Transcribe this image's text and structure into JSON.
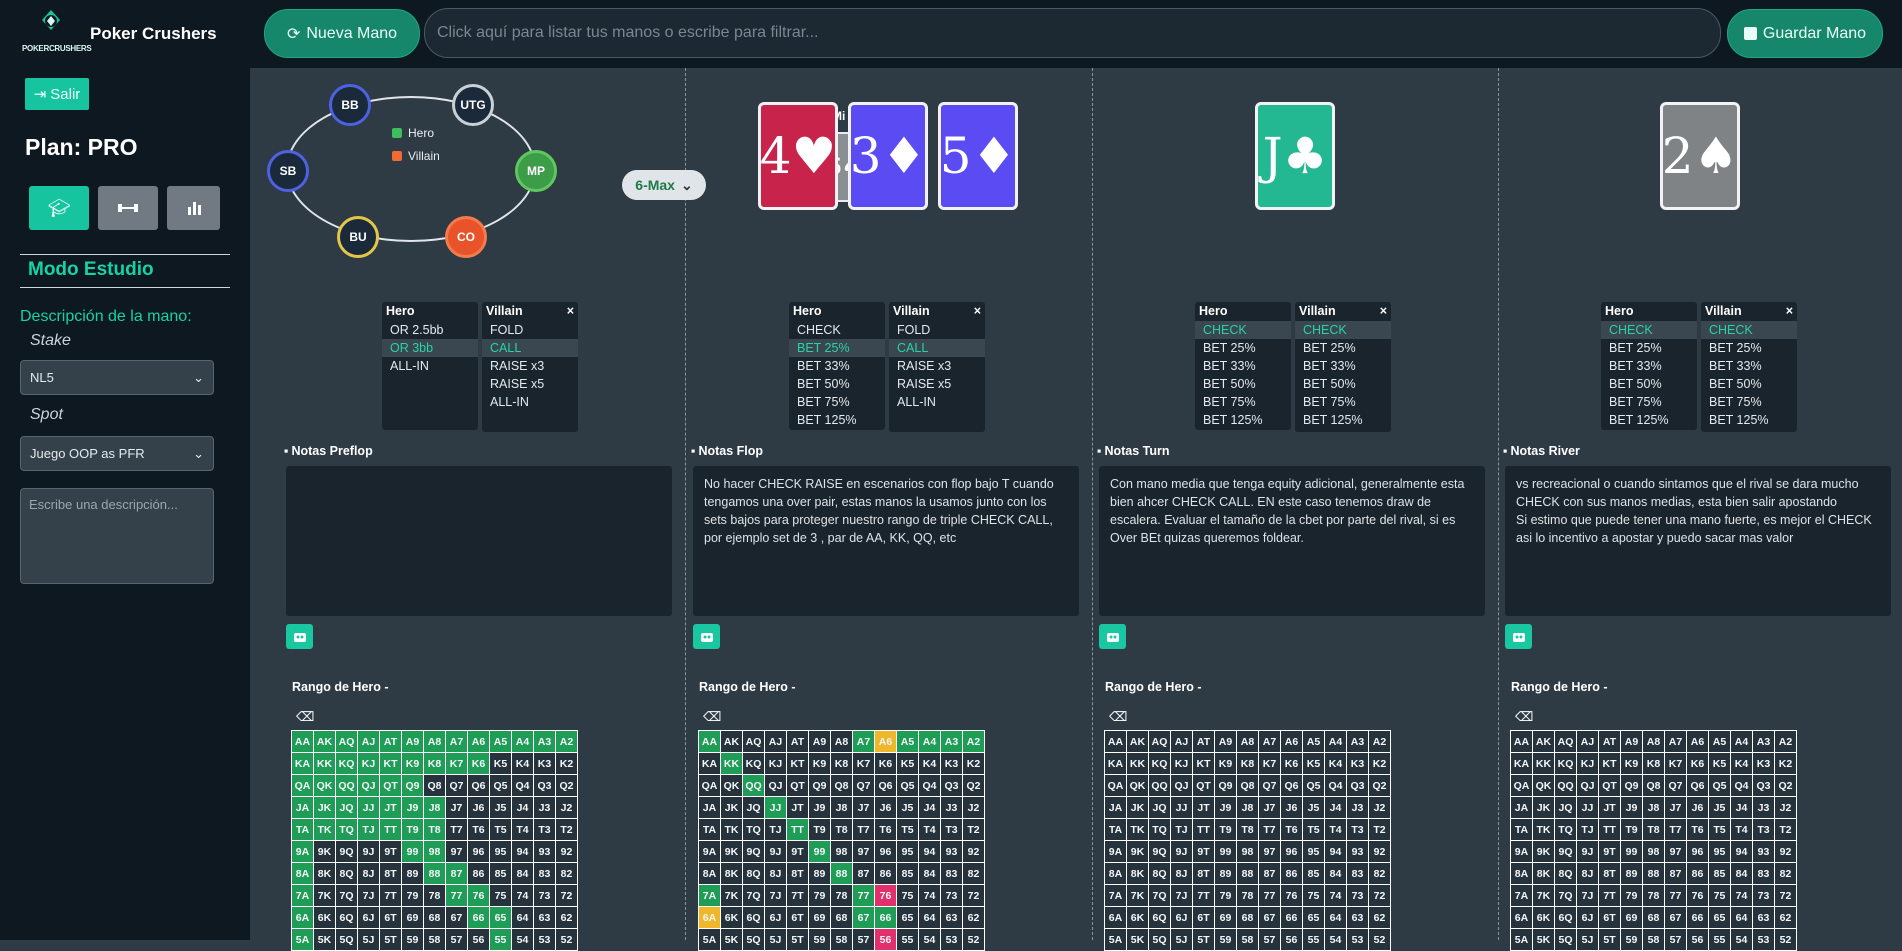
{
  "header": {
    "brand": "Poker Crushers",
    "logo_text": "POKERCRUSHERS",
    "new_hand_label": "Nueva Mano",
    "search_placeholder": "Click aquí para listar tus manos o escribe para filtrar...",
    "save_label": "Guardar Mano"
  },
  "sidebar": {
    "logout_label": "Salir",
    "plan_label": "Plan: PRO",
    "mode_title": "Modo Estudio",
    "description_label": "Descripción de la mano:",
    "stake_label": "Stake",
    "stake_value": "NL5",
    "spot_label": "Spot",
    "spot_value": "Juego OOP as PFR",
    "description_placeholder": "Escribe una descripción..."
  },
  "table": {
    "seats": [
      "BB",
      "UTG",
      "SB",
      "MP",
      "BU",
      "CO"
    ],
    "legend_hero": "Hero",
    "legend_villain": "Villain",
    "format": "6-Max",
    "my_hand_label": "Mi mano",
    "my_hand": [
      {
        "rank": "6",
        "suit": "♠",
        "color": "#8a8f94"
      },
      {
        "rank": "6",
        "suit": "♦",
        "color": "#5a4cf2"
      }
    ]
  },
  "streets": [
    {
      "cards": [],
      "hero_title": "Hero",
      "hero_options": [
        "OR 2.5bb",
        "OR 3bb",
        "ALL-IN"
      ],
      "hero_selected": 1,
      "villain_title": "Villain",
      "villain_options": [
        "FOLD",
        "CALL",
        "RAISE x3",
        "RAISE x5",
        "ALL-IN"
      ],
      "villain_selected": 1,
      "notes_title": "Notas Preflop",
      "notes": "",
      "range_title": "Rango de Hero -"
    },
    {
      "cards": [
        {
          "rank": "4",
          "suit": "♥",
          "color": "#c8234a"
        },
        {
          "rank": "3",
          "suit": "♦",
          "color": "#5a4cf2"
        },
        {
          "rank": "5",
          "suit": "♦",
          "color": "#5a4cf2"
        }
      ],
      "hero_title": "Hero",
      "hero_options": [
        "CHECK",
        "BET 25%",
        "BET 33%",
        "BET 50%",
        "BET 75%",
        "BET 125%"
      ],
      "hero_selected": 1,
      "villain_title": "Villain",
      "villain_options": [
        "FOLD",
        "CALL",
        "RAISE x3",
        "RAISE x5",
        "ALL-IN"
      ],
      "villain_selected": 1,
      "notes_title": "Notas Flop",
      "notes": "No hacer CHECK RAISE en escenarios con flop bajo T cuando tengamos una over pair, estas manos la usamos junto con los sets bajos para proteger nuestro rango de triple CHECK CALL, por ejemplo set de 3 , par de AA, KK, QQ, etc",
      "range_title": "Rango de Hero -"
    },
    {
      "cards": [
        {
          "rank": "J",
          "suit": "♣",
          "color": "#23b891"
        }
      ],
      "hero_title": "Hero",
      "hero_options": [
        "CHECK",
        "BET 25%",
        "BET 33%",
        "BET 50%",
        "BET 75%",
        "BET 125%"
      ],
      "hero_selected": 0,
      "villain_title": "Villain",
      "villain_options": [
        "CHECK",
        "BET 25%",
        "BET 33%",
        "BET 50%",
        "BET 75%",
        "BET 125%"
      ],
      "villain_selected": 0,
      "notes_title": "Notas Turn",
      "notes": "Con mano media que tenga equity adicional, generalmente esta bien ahcer CHECK CALL. EN este caso tenemos draw de escalera. Evaluar el tamaño de la cbet por parte del rival, si es Over BEt quizas queremos foldear.",
      "range_title": "Rango de Hero -"
    },
    {
      "cards": [
        {
          "rank": "2",
          "suit": "♠",
          "color": "#7f8386"
        }
      ],
      "hero_title": "Hero",
      "hero_options": [
        "CHECK",
        "BET 25%",
        "BET 33%",
        "BET 50%",
        "BET 75%",
        "BET 125%"
      ],
      "hero_selected": 0,
      "villain_title": "Villain",
      "villain_options": [
        "CHECK",
        "BET 25%",
        "BET 33%",
        "BET 50%",
        "BET 75%",
        "BET 125%"
      ],
      "villain_selected": 0,
      "notes_title": "Notas River",
      "notes": "vs recreacional o cuando sintamos que el rival se dara mucho CHECK con sus manos medias, esta bien salir apostando\nSi estimo que puede tener una mano fuerte, es mejor el CHECK asi lo incentivo a apostar y puedo sacar mas valor",
      "range_title": "Rango de Hero -"
    }
  ],
  "range_grid": {
    "rows": [
      [
        "AA",
        "AK",
        "AQ",
        "AJ",
        "AT",
        "A9",
        "A8",
        "A7",
        "A6",
        "A5",
        "A4",
        "A3",
        "A2"
      ],
      [
        "KA",
        "KK",
        "KQ",
        "KJ",
        "KT",
        "K9",
        "K8",
        "K7",
        "K6",
        "K5",
        "K4",
        "K3",
        "K2"
      ],
      [
        "QA",
        "QK",
        "QQ",
        "QJ",
        "QT",
        "Q9",
        "Q8",
        "Q7",
        "Q6",
        "Q5",
        "Q4",
        "Q3",
        "Q2"
      ],
      [
        "JA",
        "JK",
        "JQ",
        "JJ",
        "JT",
        "J9",
        "J8",
        "J7",
        "J6",
        "J5",
        "J4",
        "J3",
        "J2"
      ],
      [
        "TA",
        "TK",
        "TQ",
        "TJ",
        "TT",
        "T9",
        "T8",
        "T7",
        "T6",
        "T5",
        "T4",
        "T3",
        "T2"
      ],
      [
        "9A",
        "9K",
        "9Q",
        "9J",
        "9T",
        "99",
        "98",
        "97",
        "96",
        "95",
        "94",
        "93",
        "92"
      ],
      [
        "8A",
        "8K",
        "8Q",
        "8J",
        "8T",
        "89",
        "88",
        "87",
        "86",
        "85",
        "84",
        "83",
        "82"
      ],
      [
        "7A",
        "7K",
        "7Q",
        "7J",
        "7T",
        "79",
        "78",
        "77",
        "76",
        "75",
        "74",
        "73",
        "72"
      ],
      [
        "6A",
        "6K",
        "6Q",
        "6J",
        "6T",
        "69",
        "68",
        "67",
        "66",
        "65",
        "64",
        "63",
        "62"
      ],
      [
        "5A",
        "5K",
        "5Q",
        "5J",
        "5T",
        "59",
        "58",
        "57",
        "56",
        "55",
        "54",
        "53",
        "52"
      ]
    ]
  },
  "range_colors": [
    {
      "green": [
        "AA",
        "AK",
        "AQ",
        "AJ",
        "AT",
        "A9",
        "A8",
        "A7",
        "A6",
        "A5",
        "A4",
        "A3",
        "A2",
        "KA",
        "KK",
        "KQ",
        "KJ",
        "KT",
        "K9",
        "K8",
        "K7",
        "K6",
        "QA",
        "QK",
        "QQ",
        "QJ",
        "QT",
        "Q9",
        "JA",
        "JK",
        "JQ",
        "JJ",
        "JT",
        "J9",
        "J8",
        "TA",
        "TK",
        "TQ",
        "TJ",
        "TT",
        "T9",
        "T8",
        "9A",
        "99",
        "98",
        "8A",
        "88",
        "87",
        "7A",
        "77",
        "76",
        "6A",
        "66",
        "65",
        "5A",
        "55"
      ],
      "yellow": [],
      "pink": []
    },
    {
      "green": [
        "AA",
        "A7",
        "A5",
        "A4",
        "A3",
        "A2",
        "KK",
        "QQ",
        "JJ",
        "TT",
        "99",
        "88",
        "7A",
        "77",
        "67",
        "66"
      ],
      "yellow": [
        "A6",
        "6A"
      ],
      "pink": [
        "76",
        "56"
      ]
    },
    {
      "green": [],
      "yellow": [],
      "pink": []
    },
    {
      "green": [],
      "yellow": [],
      "pink": []
    }
  ]
}
